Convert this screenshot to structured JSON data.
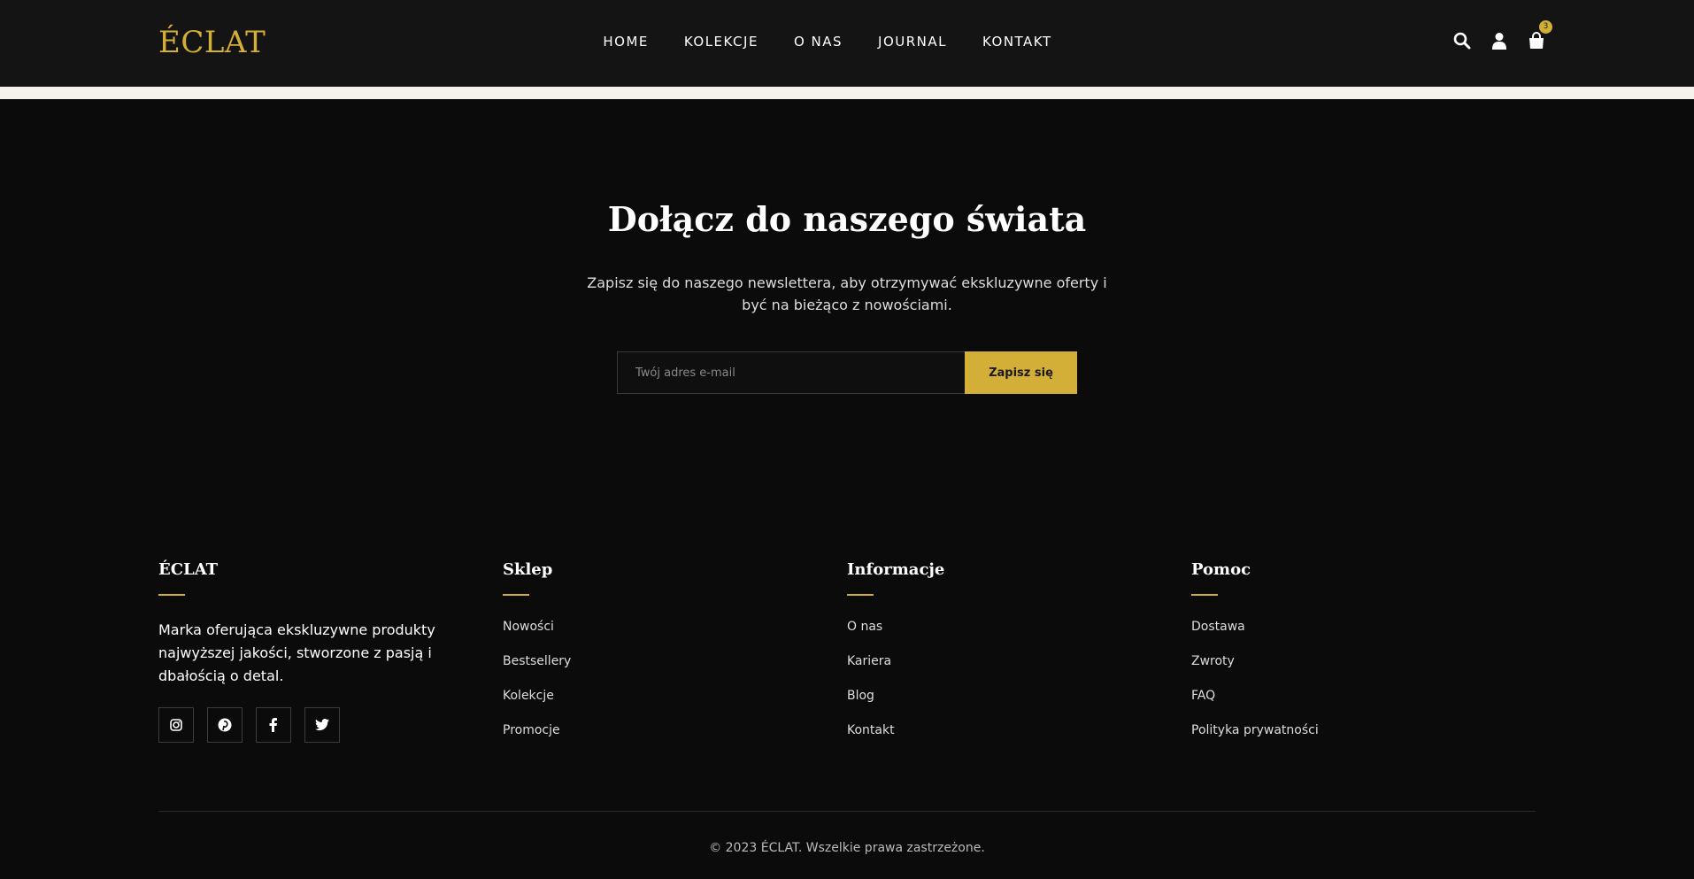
{
  "brand": "ÉCLAT",
  "nav": [
    "HOME",
    "KOLEKCJE",
    "O NAS",
    "JOURNAL",
    "KONTAKT"
  ],
  "cart_count": "3",
  "newsletter": {
    "title": "Dołącz do naszego świata",
    "description": "Zapisz się do naszego newslettera, aby otrzymywać ekskluzywne oferty i być na bieżąco z nowościami.",
    "placeholder": "Twój adres e-mail",
    "button": "Zapisz się"
  },
  "footer": {
    "brand": {
      "title": "ÉCLAT",
      "description": "Marka oferująca ekskluzywne produkty najwyższej jakości, stworzone z pasją i dbałością o detal."
    },
    "columns": [
      {
        "title": "Sklep",
        "links": [
          "Nowości",
          "Bestsellery",
          "Kolekcje",
          "Promocje"
        ]
      },
      {
        "title": "Informacje",
        "links": [
          "O nas",
          "Kariera",
          "Blog",
          "Kontakt"
        ]
      },
      {
        "title": "Pomoc",
        "links": [
          "Dostawa",
          "Zwroty",
          "FAQ",
          "Polityka prywatności"
        ]
      }
    ],
    "copyright": "© 2023 ÉCLAT. Wszelkie prawa zastrzeżone."
  },
  "colors": {
    "accent": "#d4af37",
    "background": "#0b0b0b",
    "header": "#141414"
  },
  "icons": [
    "search-icon",
    "user-icon",
    "cart-icon",
    "instagram-icon",
    "pinterest-icon",
    "facebook-icon",
    "twitter-icon"
  ]
}
